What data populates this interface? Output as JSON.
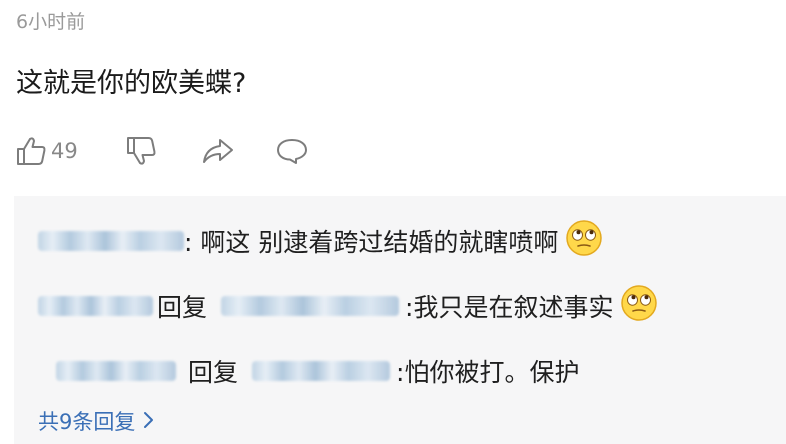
{
  "comment": {
    "timestamp": "6小时前",
    "text": "这就是你的欧美蝶?",
    "like_count": "49"
  },
  "icons": {
    "like": "thumbs-up-icon",
    "dislike": "thumbs-down-icon",
    "share": "share-arrow-icon",
    "reply": "comment-bubble-icon",
    "emoji": "rolling-eyes-emoji-icon",
    "more": "chevron-right-icon"
  },
  "replies": [
    {
      "text": ": 啊这 别逮着跨过结婚的就瞎喷啊"
    },
    {
      "reply_word": "回复",
      "text": ":我只是在叙述事实"
    },
    {
      "reply_word": "回复",
      "text": ":怕你被打。保护"
    }
  ],
  "more_replies_label": "共9条回复",
  "colors": {
    "link": "#3a6fb6",
    "muted": "#9a9a9a",
    "reply_background": "#f6f6f7"
  }
}
